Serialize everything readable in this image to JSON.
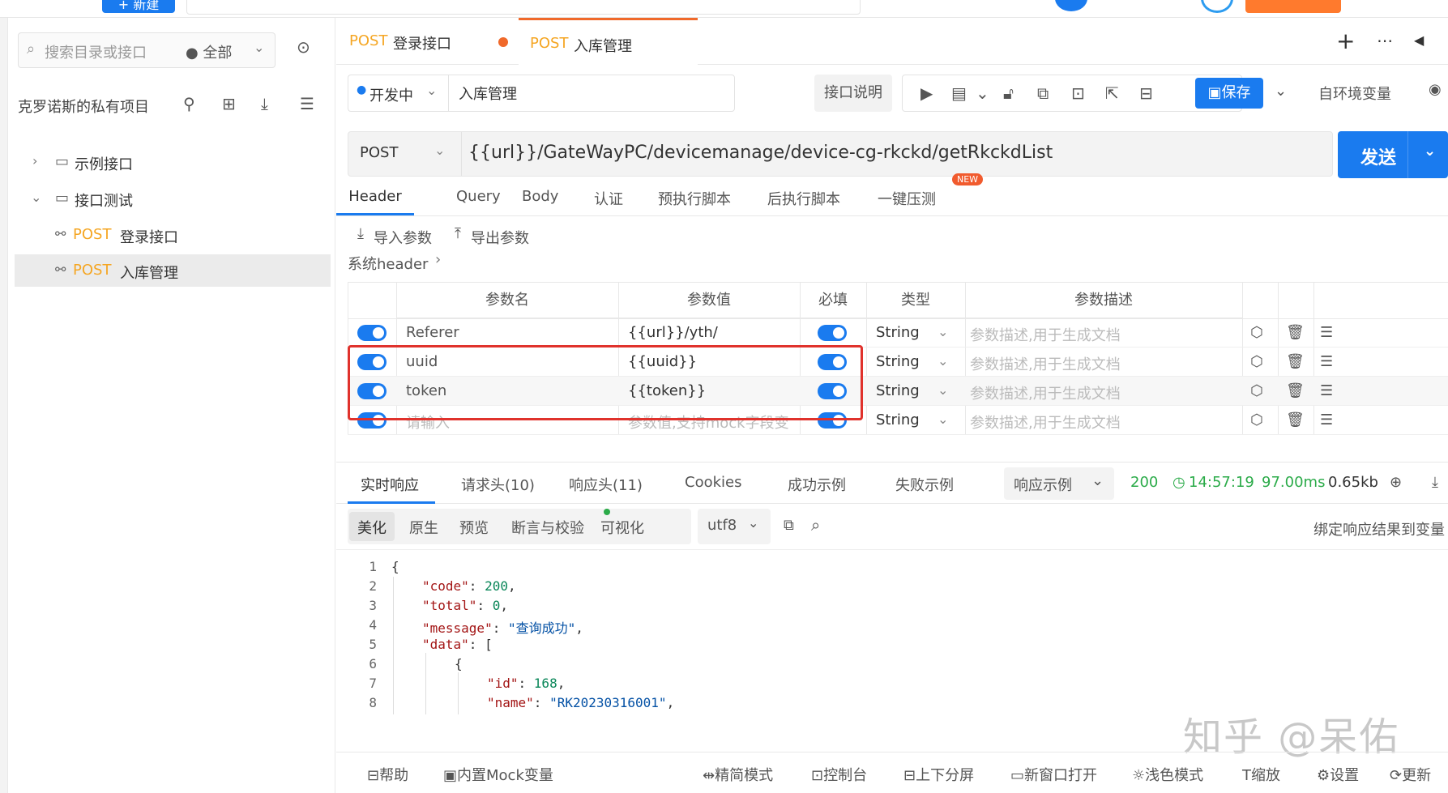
{
  "topbar": {
    "new_btn": "+ 新建"
  },
  "sidebar": {
    "search_placeholder": "搜索目录或接口",
    "filter": "● 全部",
    "project_title": "克罗诺斯的私有项目",
    "tree": [
      {
        "label": "示例接口"
      },
      {
        "label": "接口测试"
      },
      {
        "method": "POST",
        "label": "登录接口"
      },
      {
        "method": "POST",
        "label": "入库管理"
      }
    ]
  },
  "doc_tabs": [
    {
      "method": "POST",
      "label": "登录接口"
    },
    {
      "method": "POST",
      "label": "入库管理"
    }
  ],
  "toolbar": {
    "env": "开发中",
    "name_value": "入库管理",
    "doc_btn": "接口说明",
    "save": "保存",
    "env_var": "自环境变量"
  },
  "url_bar": {
    "method": "POST",
    "url": "{{url}}/GateWayPC/devicemanage/device-cg-rkckd/getRkckdList",
    "send": "发送"
  },
  "req_tabs": [
    "Header",
    "Query",
    "Body",
    "认证",
    "预执行脚本",
    "后执行脚本",
    "一键压测"
  ],
  "new_badge": "NEW",
  "header_tools": {
    "import": "导入参数",
    "export": "导出参数",
    "system_header": "系统header"
  },
  "table": {
    "headers": [
      "参数名",
      "参数值",
      "必填",
      "类型",
      "参数描述"
    ],
    "rows": [
      {
        "name": "Referer",
        "value": "{{url}}/yth/",
        "type": "String",
        "desc": "参数描述,用于生成文档"
      },
      {
        "name": "uuid",
        "value": "{{uuid}}",
        "type": "String",
        "desc": "参数描述,用于生成文档"
      },
      {
        "name": "token",
        "value": "{{token}}",
        "type": "String",
        "desc": "参数描述,用于生成文档"
      },
      {
        "name": "请输入",
        "value": "参数值,支持mock字段变",
        "type": "String",
        "desc": "参数描述,用于生成文档"
      }
    ]
  },
  "response": {
    "tabs": [
      "实时响应",
      "请求头(10)",
      "响应头(11)",
      "Cookies",
      "成功示例",
      "失败示例"
    ],
    "example": "响应示例",
    "status": "200",
    "time": "14:57:19",
    "duration": "97.00ms",
    "size": "0.65kb",
    "view_tabs": [
      "美化",
      "原生",
      "预览",
      "断言与校验",
      "可视化"
    ],
    "encoding": "utf8",
    "bind": "绑定响应结果到变量"
  },
  "code_lines": [
    "1",
    "2",
    "3",
    "4",
    "5",
    "6",
    "7",
    "8"
  ],
  "code": {
    "l1": "{",
    "code_key": "\"code\"",
    "code_val": "200",
    "total_key": "\"total\"",
    "total_val": "0",
    "message_key": "\"message\"",
    "message_val": "\"查询成功\"",
    "data_key": "\"data\"",
    "data_open": "[",
    "obj_open": "{",
    "id_key": "\"id\"",
    "id_val": "168",
    "name_key": "\"name\"",
    "name_val": "\"RK20230316001\""
  },
  "watermark": "知乎 @呆佑",
  "footer": [
    "帮助",
    "内置Mock变量",
    "精简模式",
    "控制台",
    "上下分屏",
    "新窗口打开",
    "浅色模式",
    "缩放",
    "设置",
    "更新"
  ]
}
